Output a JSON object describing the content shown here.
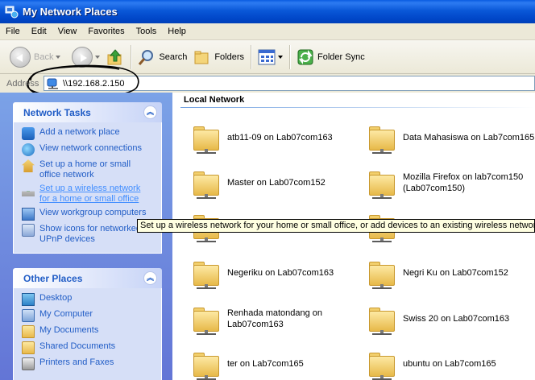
{
  "window": {
    "title": "My Network Places",
    "icon": "network-places-icon"
  },
  "menu": [
    "File",
    "Edit",
    "View",
    "Favorites",
    "Tools",
    "Help"
  ],
  "toolbar": {
    "back_label": "Back",
    "search_label": "Search",
    "folders_label": "Folders",
    "folder_sync_label": "Folder Sync"
  },
  "address": {
    "label": "Address",
    "value": "\\\\192.168.2.150"
  },
  "network_tasks": {
    "title": "Network Tasks",
    "items": [
      {
        "label": "Add a network place",
        "icon": "add-network-place-icon"
      },
      {
        "label": "View network connections",
        "icon": "network-connections-icon"
      },
      {
        "label": "Set up a home or small\noffice network",
        "icon": "home-network-icon"
      },
      {
        "label": "Set up a wireless network\nfor a home or small office",
        "icon": "wireless-network-icon"
      },
      {
        "label": "View workgroup computers",
        "icon": "workgroup-computers-icon"
      },
      {
        "label": "Show icons for networked\nUPnP devices",
        "icon": "upnp-devices-icon"
      }
    ]
  },
  "other_places": {
    "title": "Other Places",
    "items": [
      {
        "label": "Desktop",
        "icon": "desktop-icon"
      },
      {
        "label": "My Computer",
        "icon": "my-computer-icon"
      },
      {
        "label": "My Documents",
        "icon": "my-documents-icon"
      },
      {
        "label": "Shared Documents",
        "icon": "shared-documents-icon"
      },
      {
        "label": "Printers and Faxes",
        "icon": "printers-faxes-icon"
      }
    ]
  },
  "content": {
    "group_title": "Local Network",
    "shares": [
      "atb11-09 on Lab07com163",
      "Data Mahasiswa on Lab7com165",
      "Master on Lab07com152",
      "Mozilla Firefox on lab7com150\n(Lab07com150)",
      "Negeriku on Lab07com163",
      "Negri Ku on Lab07com152",
      "Renhada matondang on\nLab07com163",
      "Swiss 20 on Lab07com163",
      "ter on Lab7com165",
      "ubuntu on Lab7com165"
    ]
  },
  "tooltip": "Set up a wireless network for your home or small office, or add devices to an existing wireless network."
}
